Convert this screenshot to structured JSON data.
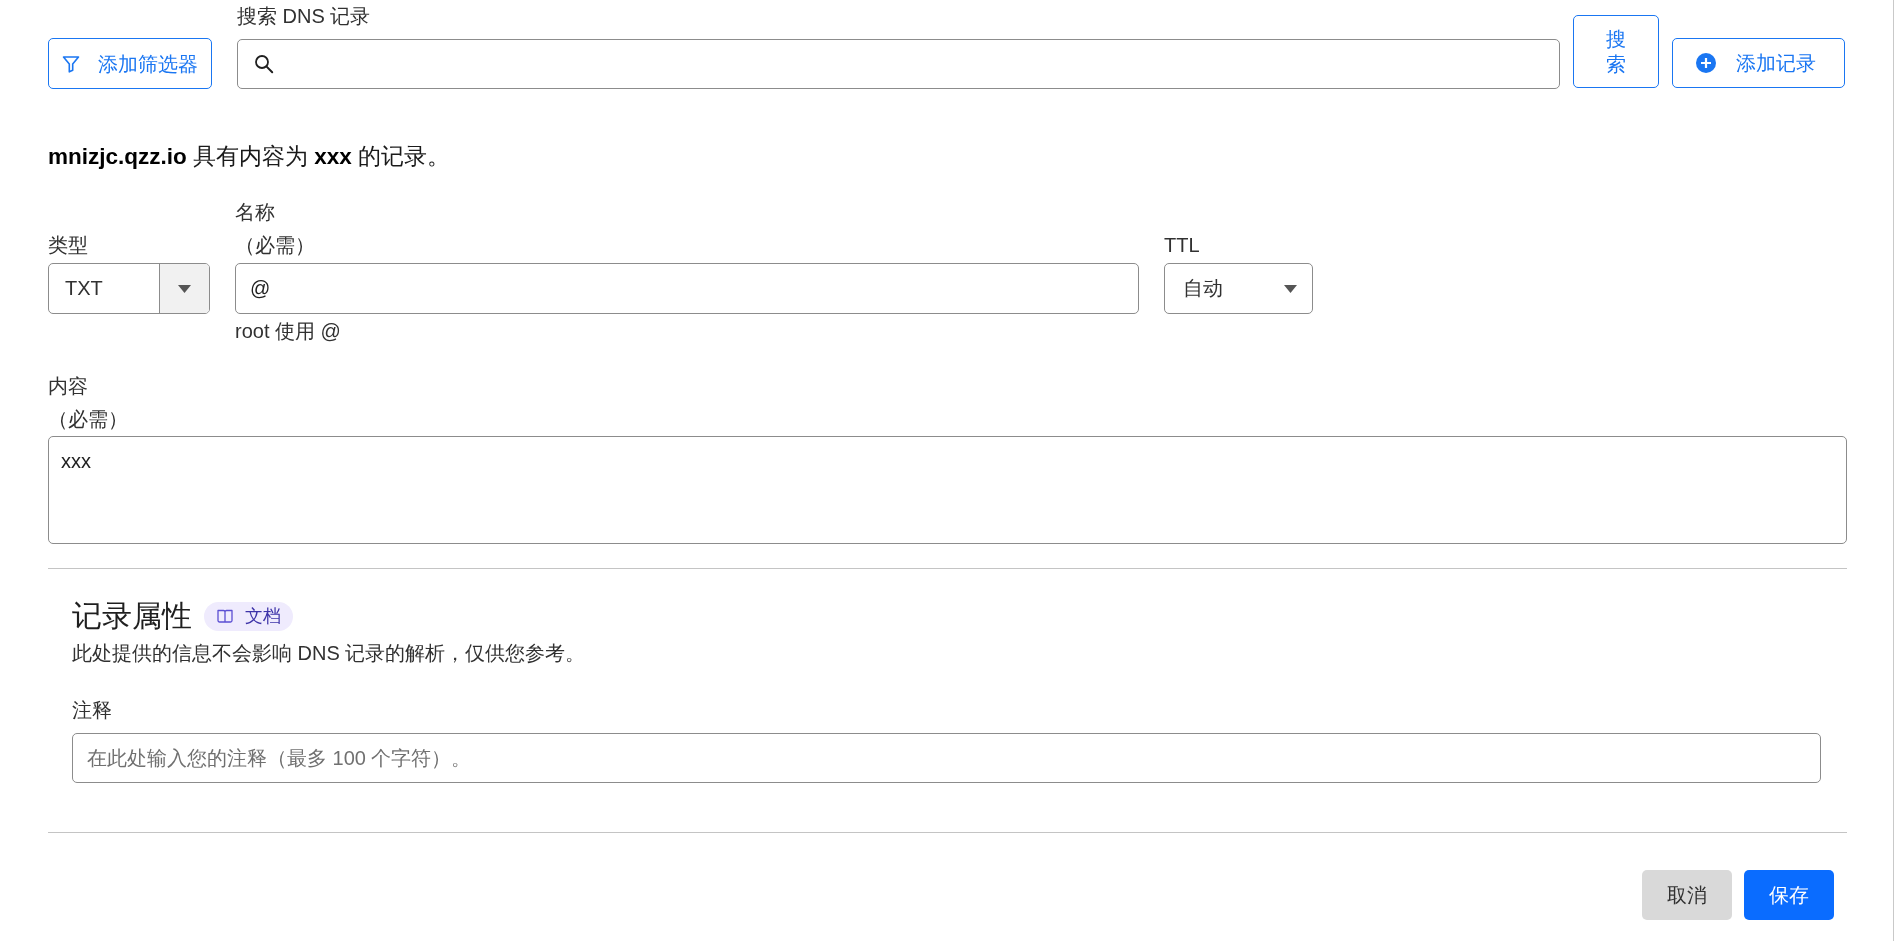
{
  "toolbar": {
    "filter_button": {
      "label": "添加筛选器"
    },
    "search": {
      "label": "搜索 DNS 记录"
    },
    "search_button": {
      "label": "搜索"
    },
    "add_button": {
      "label": "添加记录"
    }
  },
  "summary": "**mnizjc.qzz.io** 具有内容为 **xxx** 的记录。",
  "record_form": {
    "type": {
      "label": "类型",
      "value": "TXT"
    },
    "name": {
      "label": "名称",
      "required": "（必需）",
      "value": "@",
      "hint": "root 使用 @"
    },
    "ttl": {
      "label": "TTL",
      "value": "自动"
    },
    "content": {
      "label": "内容",
      "required": "（必需）",
      "value": "xxx"
    }
  },
  "record_attributes": {
    "title": "记录属性",
    "docs_badge": "文档",
    "description": "此处提供的信息不会影响 DNS 记录的解析，仅供您参考。",
    "comment": {
      "label": "注释",
      "placeholder": "在此处输入您的注释（最多 100 个字符）。"
    }
  },
  "actions": [
    {
      "label": "取消",
      "kind": "secondary"
    },
    {
      "label": "保存",
      "kind": "primary"
    }
  ]
}
